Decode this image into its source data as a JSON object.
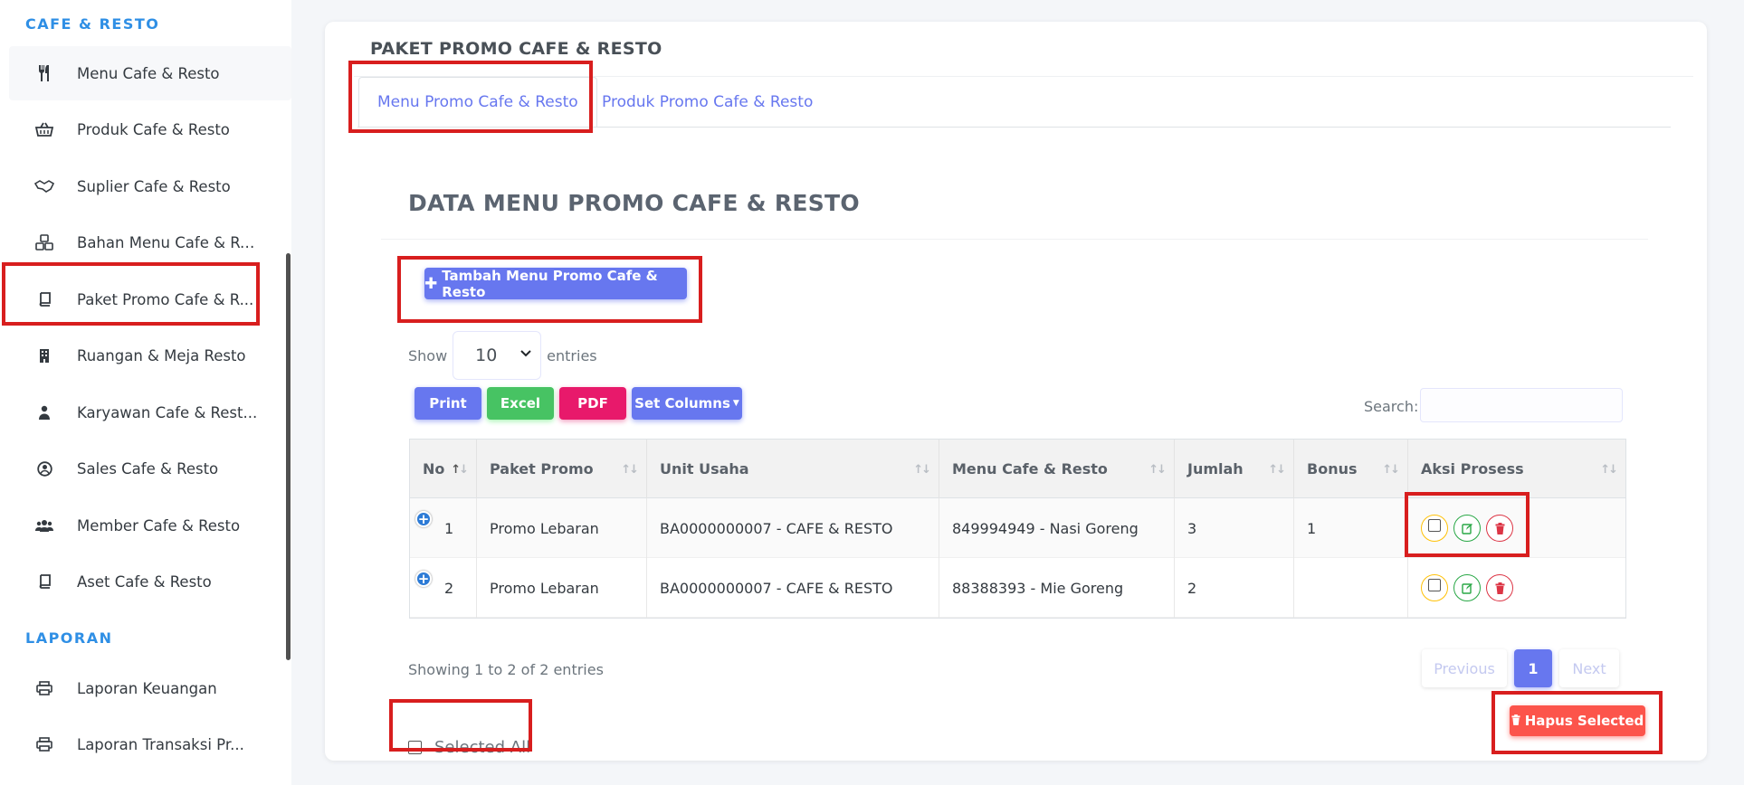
{
  "sidebar": {
    "section_cafe": "CAFE & RESTO",
    "section_laporan": "LAPORAN",
    "items": [
      {
        "label": "Menu Cafe & Resto",
        "icon": "utensils-icon",
        "glyph": "🍴"
      },
      {
        "label": "Produk Cafe & Resto",
        "icon": "basket-icon",
        "glyph": "🧺"
      },
      {
        "label": "Suplier Cafe & Resto",
        "icon": "handshake-icon",
        "glyph": "🤝"
      },
      {
        "label": "Bahan Menu Cafe & Re...",
        "icon": "cubes-icon",
        "glyph": "⛁"
      },
      {
        "label": "Paket Promo Cafe & R...",
        "icon": "book-icon",
        "glyph": "📘"
      },
      {
        "label": "Ruangan & Meja Resto",
        "icon": "building-icon",
        "glyph": "▤"
      },
      {
        "label": "Karyawan Cafe & Rest...",
        "icon": "user-tie-icon",
        "glyph": "👤"
      },
      {
        "label": "Sales Cafe & Resto",
        "icon": "user-circle-icon",
        "glyph": "◉"
      },
      {
        "label": "Member Cafe & Resto",
        "icon": "users-icon",
        "glyph": "👥"
      },
      {
        "label": "Aset Cafe & Resto",
        "icon": "book-icon",
        "glyph": "📘"
      }
    ],
    "laporan_items": [
      {
        "label": "Laporan Keuangan",
        "icon": "print-icon",
        "glyph": "🖶"
      },
      {
        "label": "Laporan Transaksi Pr...",
        "icon": "print-icon",
        "glyph": "🖶"
      }
    ]
  },
  "card": {
    "title": "PAKET PROMO CAFE & RESTO",
    "tabs": [
      {
        "label": "Menu Promo Cafe & Resto"
      },
      {
        "label": "Produk Promo Cafe & Resto"
      }
    ]
  },
  "section": {
    "title": "DATA MENU PROMO CAFE & RESTO",
    "add_button": "Tambah Menu Promo Cafe & Resto",
    "show_label": "Show",
    "entries_value": "10",
    "entries_label": "entries",
    "export_buttons": {
      "print": "Print",
      "excel": "Excel",
      "pdf": "PDF",
      "columns": "Set Columns"
    },
    "search_label": "Search:",
    "search_value": ""
  },
  "table": {
    "headers": [
      "No",
      "Paket Promo",
      "Unit Usaha",
      "Menu Cafe & Resto",
      "Jumlah",
      "Bonus",
      "Aksi Prosess"
    ],
    "rows": [
      {
        "no": "1",
        "paket": "Promo Lebaran",
        "unit": "BA0000000007 - CAFE & RESTO",
        "menu": "849994949 - Nasi Goreng",
        "jumlah": "3",
        "bonus": "1"
      },
      {
        "no": "2",
        "paket": "Promo Lebaran",
        "unit": "BA0000000007 - CAFE & RESTO",
        "menu": "88388393 - Mie Goreng",
        "jumlah": "2",
        "bonus": ""
      }
    ]
  },
  "footer": {
    "info": "Showing 1 to 2 of 2 entries",
    "previous": "Previous",
    "page": "1",
    "next": "Next",
    "selected_all": "Selected All",
    "hapus_selected": "Hapus Selected"
  },
  "colors": {
    "primary": "#6777ef",
    "success": "#47c363",
    "danger": "#fc544b",
    "pink": "#e8196b",
    "annotation": "#d81e1e"
  }
}
